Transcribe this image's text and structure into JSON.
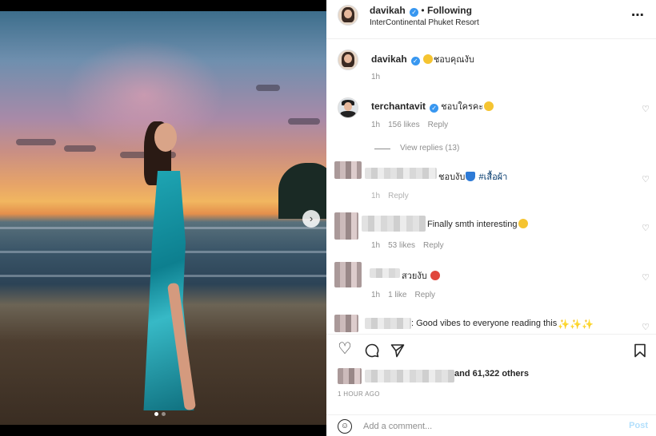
{
  "media": {
    "next_label": "›",
    "dots": 2,
    "active_dot": 0
  },
  "header": {
    "username": "davikah",
    "separator": "•",
    "follow_status": "Following",
    "location": "InterContinental Phuket Resort",
    "more": "⋯"
  },
  "caption": {
    "username": "davikah",
    "text": "ชอบคุณงับ",
    "time": "1h"
  },
  "comments": [
    {
      "username": "terchantavit",
      "text": "ชอบใครคะ",
      "time": "1h",
      "likes": "156 likes",
      "reply": "Reply",
      "view_replies": "View replies (13)"
    },
    {
      "username": "",
      "text": "ชอบงับ",
      "hashtag": "#เสื้อผ้า",
      "time": "1h",
      "reply": "Reply"
    },
    {
      "username": "",
      "text": "Finally smth interesting",
      "time": "1h",
      "likes": "53 likes",
      "reply": "Reply"
    },
    {
      "username": "",
      "text": "สวยงับ",
      "time": "1h",
      "likes": "1 like",
      "reply": "Reply"
    },
    {
      "username": "",
      "text": ": Good vibes to everyone reading this"
    }
  ],
  "likes_text": "and 61,322 others",
  "post_time": "1 HOUR AGO",
  "add_comment": {
    "placeholder": "Add a comment...",
    "post_label": "Post"
  },
  "icons": [
    "heart-icon",
    "comment-icon",
    "share-icon",
    "bookmark-icon",
    "emoji-icon",
    "more-icon",
    "verified-icon"
  ],
  "colors": {
    "verified": "#3897f0",
    "post_button": "#b2dffc",
    "meta": "#8e8e8e",
    "hashtag": "#00376b"
  }
}
